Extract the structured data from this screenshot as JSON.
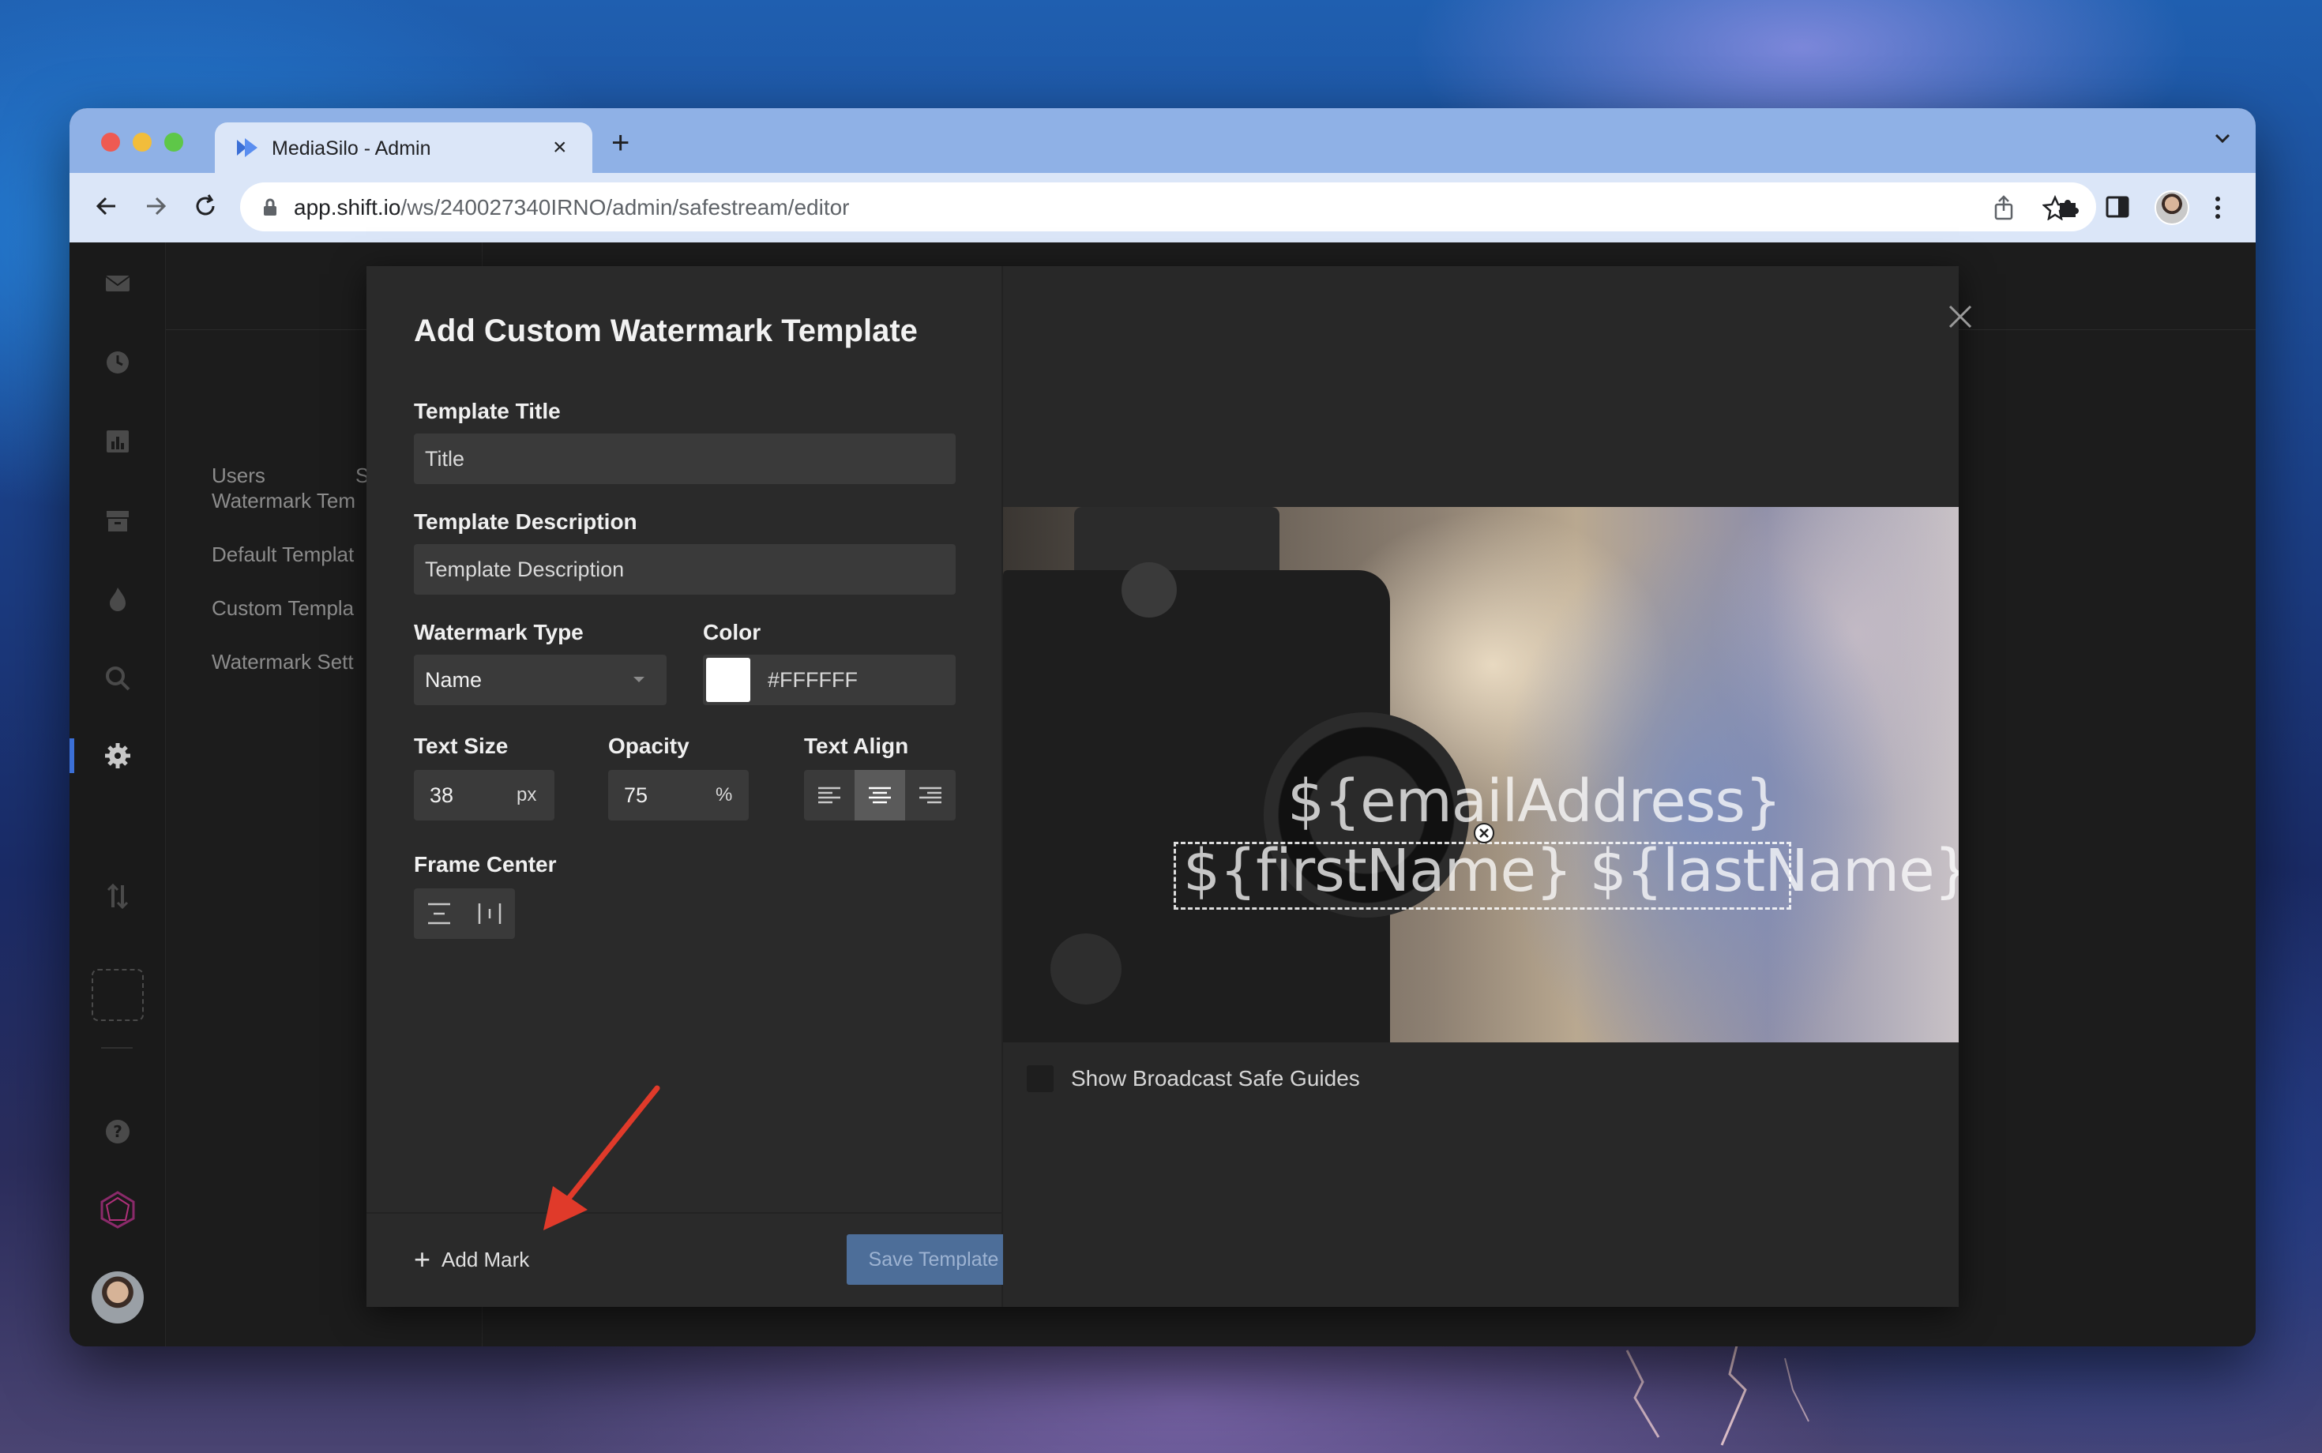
{
  "browser": {
    "tab_title": "MediaSilo - Admin",
    "url_host": "app.shift.io",
    "url_path": "/ws/240027340IRNO/admin/safestream/editor"
  },
  "background_app": {
    "tabs": [
      "Users",
      "S"
    ],
    "side_items": [
      "Watermark Tem",
      "Default Templat",
      "Custom Templa",
      "Watermark Sett"
    ]
  },
  "modal": {
    "title": "Add Custom Watermark Template",
    "template_title": {
      "label": "Template Title",
      "placeholder": "Title"
    },
    "template_description": {
      "label": "Template Description",
      "placeholder": "Template Description"
    },
    "watermark_type": {
      "label": "Watermark Type",
      "value": "Name"
    },
    "color": {
      "label": "Color",
      "value": "#FFFFFF"
    },
    "text_size": {
      "label": "Text Size",
      "value": "38",
      "unit": "px"
    },
    "opacity": {
      "label": "Opacity",
      "value": "75",
      "unit": "%"
    },
    "text_align": {
      "label": "Text Align",
      "selected": "center"
    },
    "frame_center": {
      "label": "Frame Center"
    },
    "add_mark_label": "Add Mark",
    "save_label": "Save Template"
  },
  "preview": {
    "watermark_line_1": "${emailAddress}",
    "watermark_line_2": "${firstName} ${lastName}",
    "guides_label": "Show Broadcast Safe Guides",
    "guides_checked": false
  },
  "icons": {
    "rail": [
      "mail-icon",
      "clock-icon",
      "chart-icon",
      "archive-icon",
      "flame-icon",
      "search-icon",
      "gear-icon",
      "sort-icon",
      "help-icon",
      "logo-icon"
    ]
  },
  "colors": {
    "accent": "#3b6fd6",
    "save_button": "#4d6e99",
    "annotation_arrow": "#e03a2a"
  }
}
